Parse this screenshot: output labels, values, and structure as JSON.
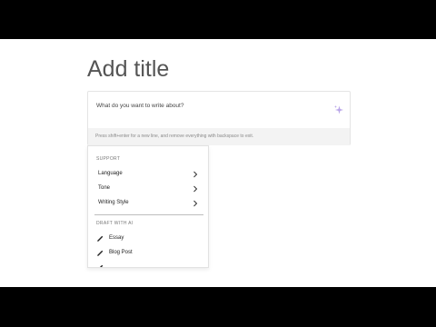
{
  "editor": {
    "title": "Add title",
    "prompt_placeholder": "What do you want to write about?",
    "hint": "Press shift+enter for a new line, and remove everything with backspace to exit."
  },
  "menu": {
    "support_label": "SUPPORT",
    "support_items": [
      {
        "label": "Language"
      },
      {
        "label": "Tone"
      },
      {
        "label": "Writing Style"
      }
    ],
    "draft_label": "DRAFT WITH AI",
    "draft_items": [
      {
        "label": "Essay",
        "icon": "pen-icon"
      },
      {
        "label": "Blog Post",
        "icon": "pen-icon"
      },
      {
        "label": "",
        "icon": "pen-icon"
      }
    ]
  },
  "colors": {
    "letterbox": "#000000",
    "sparkle": "#b9a6e8",
    "hint_bg": "#f3f3f3"
  }
}
